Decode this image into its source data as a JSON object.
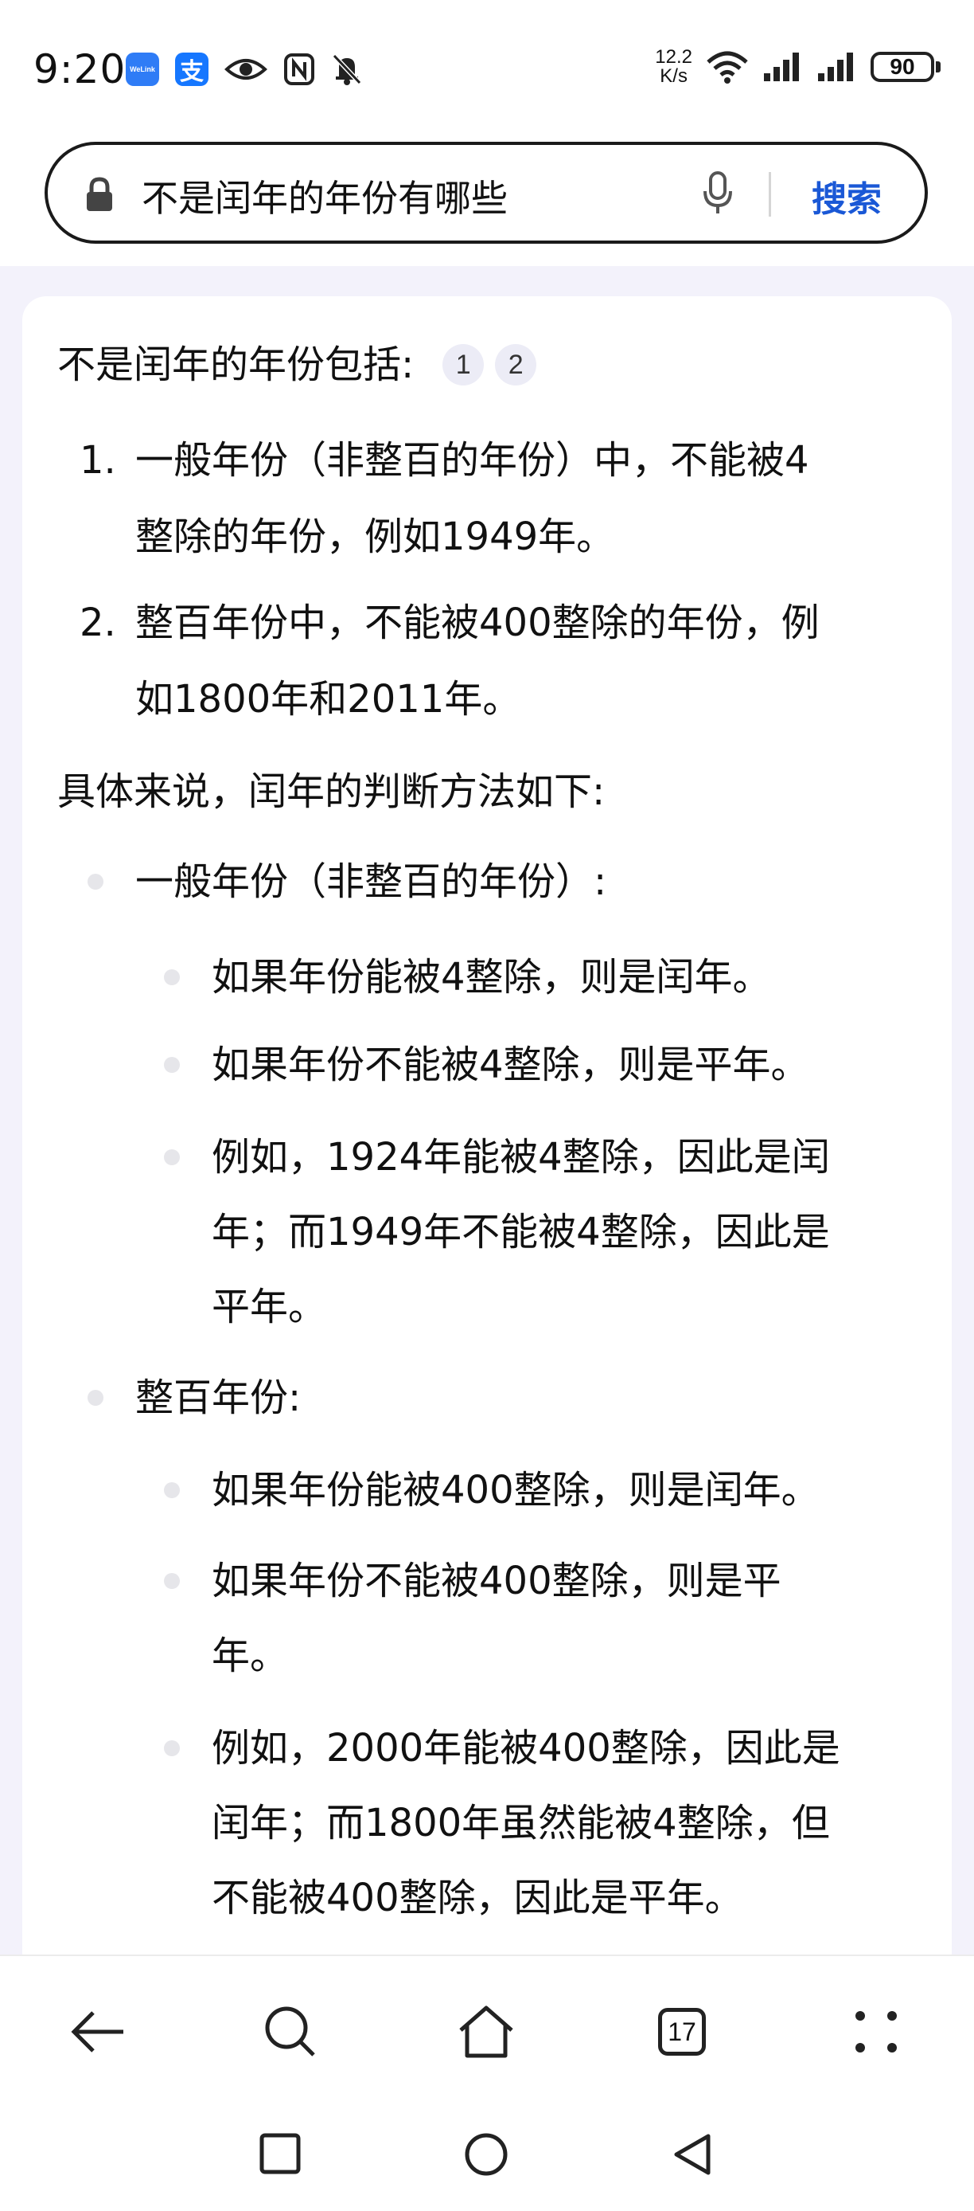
{
  "status_bar": {
    "time": "9:20",
    "left_icons": [
      "welink-app-icon",
      "alipay-app-icon",
      "eye-icon",
      "nfc-icon",
      "bell-off-icon"
    ],
    "welink_label": "WeLink",
    "alipay_label": "支",
    "net_speed_value": "12.2",
    "net_speed_unit": "K/s",
    "battery_level": "90",
    "right_icons": [
      "wifi-icon",
      "signal-icon",
      "signal-icon",
      "battery-icon"
    ]
  },
  "search": {
    "query": "不是闰年的年份有哪些",
    "button_label": "搜索",
    "icons": [
      "lock-icon",
      "mic-icon"
    ]
  },
  "answer": {
    "intro": "不是闰年的年份包括:",
    "citations": [
      "1",
      "2"
    ],
    "list": [
      {
        "num": "1.",
        "lines": [
          "一般年份（非整百的年份）中，不能被4",
          "整除的年份，例如1949年。"
        ]
      },
      {
        "num": "2.",
        "lines": [
          "整百年份中，不能被400整除的年份，例",
          "如1800年和2011年。"
        ]
      }
    ],
    "method_intro": "具体来说，闰年的判断方法如下:",
    "groups": [
      {
        "title": "一般年份（非整百的年份）:",
        "items": [
          {
            "lines": [
              "如果年份能被4整除，则是闰年。"
            ]
          },
          {
            "lines": [
              "如果年份不能被4整除，则是平年。"
            ]
          },
          {
            "lines": [
              "例如，1924年能被4整除，因此是闰",
              "年；而1949年不能被4整除，因此是",
              "平年。"
            ]
          }
        ]
      },
      {
        "title": "整百年份:",
        "items": [
          {
            "lines": [
              "如果年份能被400整除，则是闰年。"
            ]
          },
          {
            "lines": [
              "如果年份不能被400整除，则是平",
              "年。"
            ]
          },
          {
            "lines": [
              "例如，2000年能被400整除，因此是",
              "闰年；而1800年虽然能被4整除，但",
              "不能被400整除，因此是平年。"
            ]
          }
        ]
      }
    ]
  },
  "bottom_nav": {
    "tab_count": "17",
    "icons": [
      "back-arrow-icon",
      "search-icon",
      "home-icon",
      "tabs-icon",
      "more-icon"
    ]
  },
  "system_nav": {
    "icons": [
      "recents-square-icon",
      "home-circle-icon",
      "back-triangle-icon"
    ]
  },
  "colors": {
    "accent": "#1a58d6",
    "background_tint": "#f3f2fb",
    "citation_bg": "#ececf6"
  }
}
